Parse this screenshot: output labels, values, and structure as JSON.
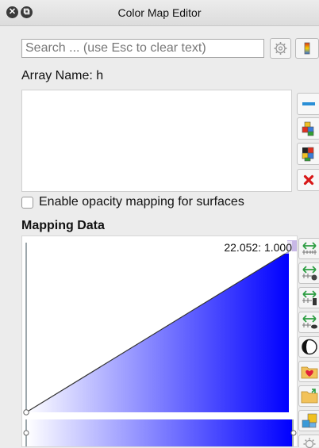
{
  "window": {
    "title": "Color Map Editor"
  },
  "search": {
    "placeholder": "Search ... (use Esc to clear text)"
  },
  "array": {
    "label": "Array Name: h"
  },
  "opacity": {
    "label": "Enable opacity mapping for surfaces",
    "checked": false
  },
  "mapping": {
    "title": "Mapping Data",
    "last_point_label": "22.052: 1.000",
    "colors": {
      "start": "#ffffff",
      "end": "#0000ff"
    }
  },
  "icons": {
    "close": "close-icon",
    "restore": "restore-icon",
    "settings": "gear-icon",
    "colormap": "colormap-icon"
  }
}
